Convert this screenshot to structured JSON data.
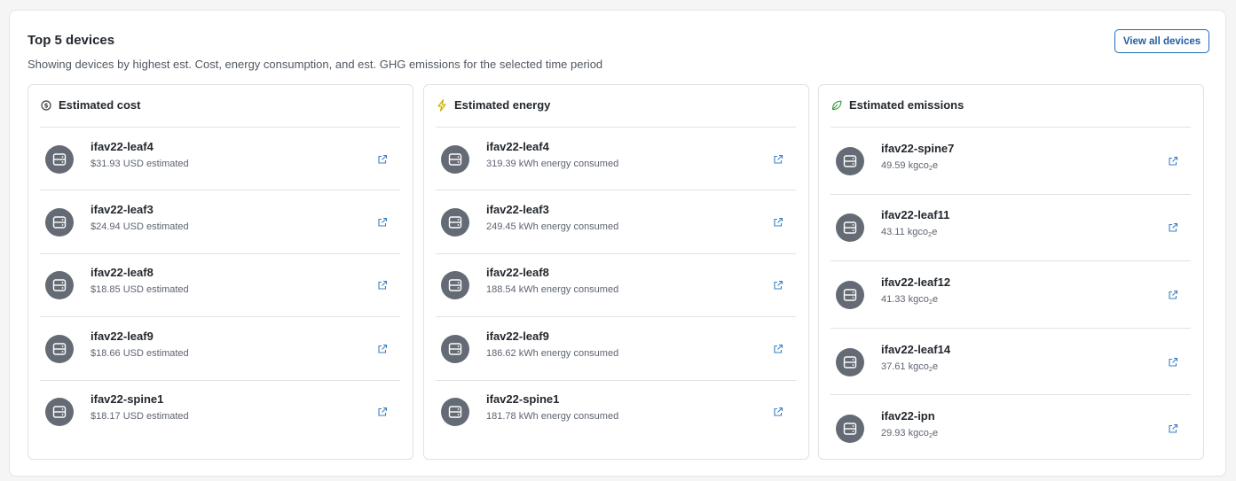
{
  "header": {
    "title": "Top 5 devices",
    "subtitle": "Showing devices by highest est. Cost, energy consumption, and est. GHG emissions for the selected time period",
    "view_all_label": "View all devices"
  },
  "colors": {
    "accent": "#1f6ab6",
    "avatar_bg": "#656b75",
    "energy_icon": "#c9b000",
    "emissions_icon": "#3d9b3d"
  },
  "panels": [
    {
      "title": "Estimated cost",
      "icon": "dollar-circle-icon",
      "rows": [
        {
          "name": "ifav22-leaf4",
          "value": "$31.93 USD estimated"
        },
        {
          "name": "ifav22-leaf3",
          "value": "$24.94 USD estimated"
        },
        {
          "name": "ifav22-leaf8",
          "value": "$18.85 USD estimated"
        },
        {
          "name": "ifav22-leaf9",
          "value": "$18.66 USD estimated"
        },
        {
          "name": "ifav22-spine1",
          "value": "$18.17 USD estimated"
        }
      ]
    },
    {
      "title": "Estimated energy",
      "icon": "lightning-bolt-icon",
      "rows": [
        {
          "name": "ifav22-leaf4",
          "value": "319.39 kWh energy consumed"
        },
        {
          "name": "ifav22-leaf3",
          "value": "249.45 kWh energy consumed"
        },
        {
          "name": "ifav22-leaf8",
          "value": "188.54 kWh energy consumed"
        },
        {
          "name": "ifav22-leaf9",
          "value": "186.62 kWh energy consumed"
        },
        {
          "name": "ifav22-spine1",
          "value": "181.78 kWh energy consumed"
        }
      ]
    },
    {
      "title": "Estimated emissions",
      "icon": "leaf-icon",
      "unit_prefix": "kgco",
      "unit_sub": "2",
      "unit_suffix": "e",
      "rows": [
        {
          "name": "ifav22-spine7",
          "value": "49.59"
        },
        {
          "name": "ifav22-leaf11",
          "value": "43.11"
        },
        {
          "name": "ifav22-leaf12",
          "value": "41.33"
        },
        {
          "name": "ifav22-leaf14",
          "value": "37.61"
        },
        {
          "name": "ifav22-ipn",
          "value": "29.93"
        }
      ]
    }
  ]
}
